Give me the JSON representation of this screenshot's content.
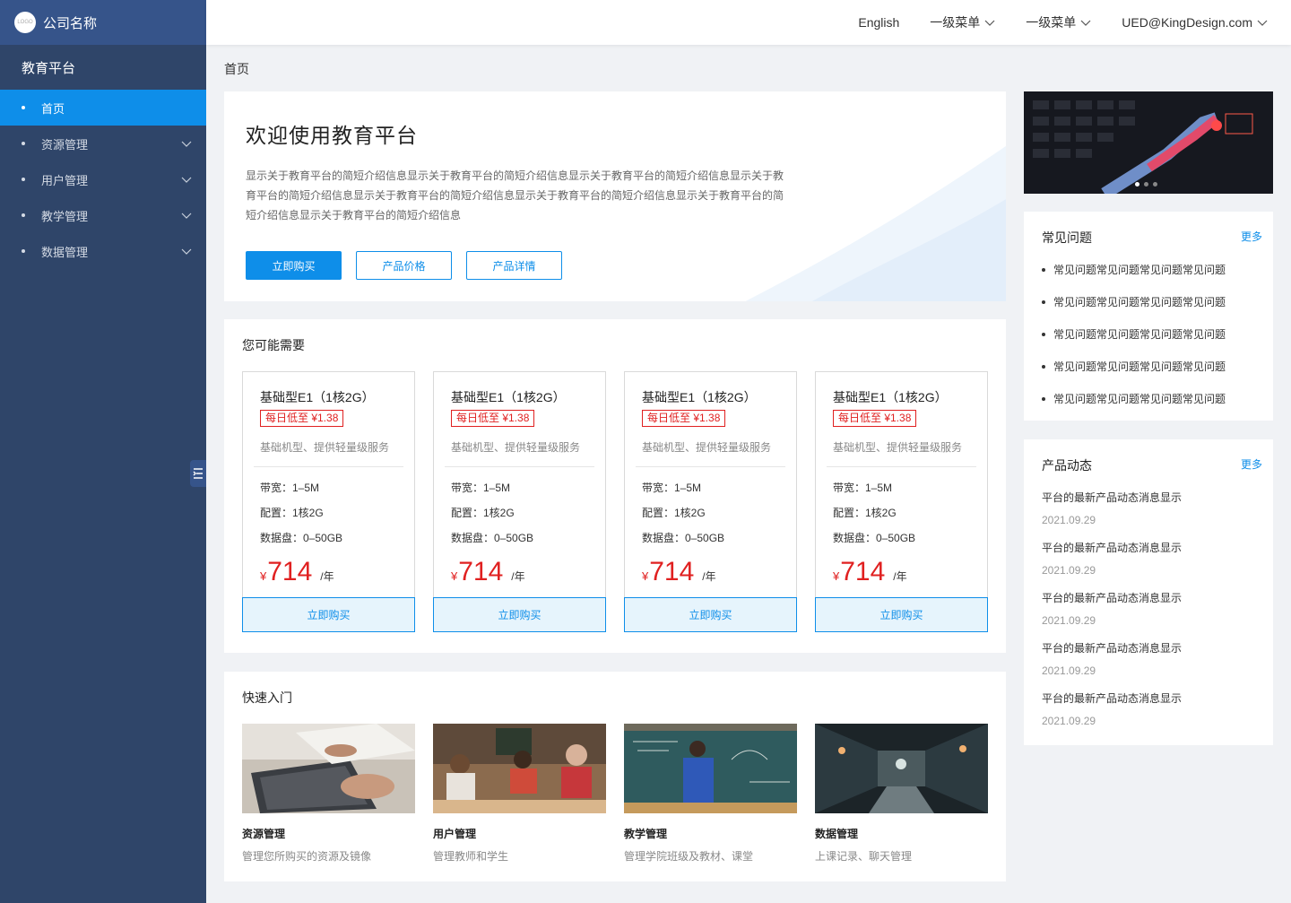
{
  "brand": {
    "logo_text": "LOGO",
    "company": "公司名称"
  },
  "sidebar": {
    "title": "教育平台",
    "items": [
      {
        "label": "首页",
        "active": true,
        "expandable": false
      },
      {
        "label": "资源管理",
        "active": false,
        "expandable": true
      },
      {
        "label": "用户管理",
        "active": false,
        "expandable": true
      },
      {
        "label": "教学管理",
        "active": false,
        "expandable": true
      },
      {
        "label": "数据管理",
        "active": false,
        "expandable": true
      }
    ]
  },
  "topbar": {
    "language": "English",
    "menu1": "一级菜单",
    "menu2": "一级菜单",
    "user": "UED@KingDesign.com"
  },
  "breadcrumb": "首页",
  "welcome": {
    "title": "欢迎使用教育平台",
    "description": "显示关于教育平台的简短介绍信息显示关于教育平台的简短介绍信息显示关于教育平台的简短介绍信息显示关于教育平台的简短介绍信息显示关于教育平台的简短介绍信息显示关于教育平台的简短介绍信息显示关于教育平台的简短介绍信息显示关于教育平台的简短介绍信息",
    "buy_label": "立即购买",
    "price_label": "产品价格",
    "detail_label": "产品详情"
  },
  "products": {
    "title": "您可能需要",
    "items": [
      {
        "name": "基础型E1（1核2G）",
        "tag": "每日低至 ¥1.38",
        "desc": "基础机型、提供轻量级服务",
        "bandwidth": "带宽：1–5M",
        "config": "配置：1核2G",
        "disk": "数据盘：0–50GB",
        "currency": "¥",
        "price": "714",
        "unit": "/年",
        "buy": "立即购买"
      },
      {
        "name": "基础型E1（1核2G）",
        "tag": "每日低至 ¥1.38",
        "desc": "基础机型、提供轻量级服务",
        "bandwidth": "带宽：1–5M",
        "config": "配置：1核2G",
        "disk": "数据盘：0–50GB",
        "currency": "¥",
        "price": "714",
        "unit": "/年",
        "buy": "立即购买"
      },
      {
        "name": "基础型E1（1核2G）",
        "tag": "每日低至 ¥1.38",
        "desc": "基础机型、提供轻量级服务",
        "bandwidth": "带宽：1–5M",
        "config": "配置：1核2G",
        "disk": "数据盘：0–50GB",
        "currency": "¥",
        "price": "714",
        "unit": "/年",
        "buy": "立即购买"
      },
      {
        "name": "基础型E1（1核2G）",
        "tag": "每日低至 ¥1.38",
        "desc": "基础机型、提供轻量级服务",
        "bandwidth": "带宽：1–5M",
        "config": "配置：1核2G",
        "disk": "数据盘：0–50GB",
        "currency": "¥",
        "price": "714",
        "unit": "/年",
        "buy": "立即购买"
      }
    ]
  },
  "quick": {
    "title": "快速入门",
    "items": [
      {
        "title": "资源管理",
        "desc": "管理您所购买的资源及镜像"
      },
      {
        "title": "用户管理",
        "desc": "管理教师和学生"
      },
      {
        "title": "教学管理",
        "desc": "管理学院班级及教材、课堂"
      },
      {
        "title": "数据管理",
        "desc": "上课记录、聊天管理"
      }
    ]
  },
  "faq": {
    "title": "常见问题",
    "more": "更多",
    "items": [
      "常见问题常见问题常见问题常见问题",
      "常见问题常见问题常见问题常见问题",
      "常见问题常见问题常见问题常见问题",
      "常见问题常见问题常见问题常见问题",
      "常见问题常见问题常见问题常见问题"
    ]
  },
  "news": {
    "title": "产品动态",
    "more": "更多",
    "items": [
      {
        "text": "平台的最新产品动态消息显示",
        "date": "2021.09.29"
      },
      {
        "text": "平台的最新产品动态消息显示",
        "date": "2021.09.29"
      },
      {
        "text": "平台的最新产品动态消息显示",
        "date": "2021.09.29"
      },
      {
        "text": "平台的最新产品动态消息显示",
        "date": "2021.09.29"
      },
      {
        "text": "平台的最新产品动态消息显示",
        "date": "2021.09.29"
      }
    ]
  },
  "banner": {
    "slides": 3,
    "active_slide": 1
  },
  "colors": {
    "primary": "#0e8ee9",
    "sidebar": "#2f4569",
    "price": "#e02020"
  }
}
